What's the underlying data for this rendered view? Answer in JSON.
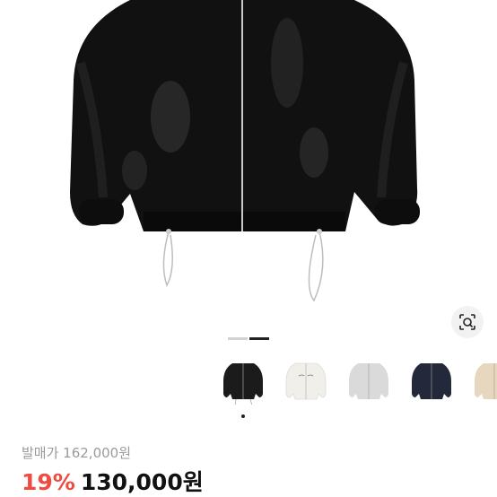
{
  "product": {
    "main_image_icon": "black-windbreaker-jacket",
    "gallery_total": 2,
    "gallery_active_index": 1,
    "lens_icon": "image-search-icon",
    "color_thumbs": [
      {
        "name": "black",
        "color": "#1b1b1b"
      },
      {
        "name": "ivory",
        "color": "#f1efe9"
      },
      {
        "name": "light-gray",
        "color": "#dadada"
      },
      {
        "name": "navy",
        "color": "#23283a"
      },
      {
        "name": "beige",
        "color": "#e8d7bf"
      }
    ],
    "selected_thumb": 0
  },
  "price": {
    "retail_label": "발매가 162,000원",
    "discount": "19%",
    "sale": "130,000원",
    "discount_color": "#f04b40"
  }
}
